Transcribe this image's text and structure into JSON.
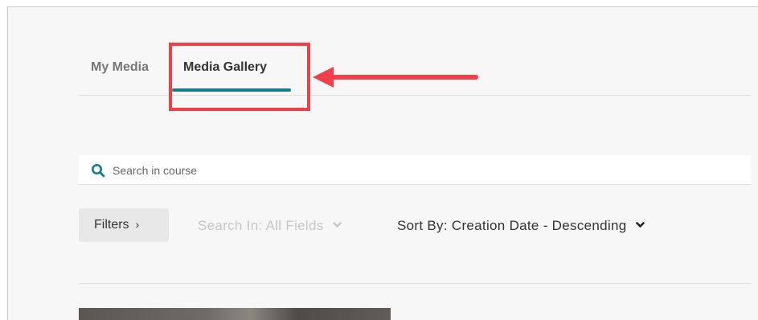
{
  "tabs": {
    "my_media": "My Media",
    "media_gallery": "Media Gallery"
  },
  "search": {
    "placeholder": "Search in course",
    "icon": "search-icon"
  },
  "toolbar": {
    "filters_label": "Filters",
    "filters_chevron": "›",
    "search_in_label": "Search In: All Fields",
    "sort_by_label": "Sort By: Creation Date - Descending"
  },
  "colors": {
    "accent": "#1a7a8e",
    "annotation": "#f04048"
  }
}
